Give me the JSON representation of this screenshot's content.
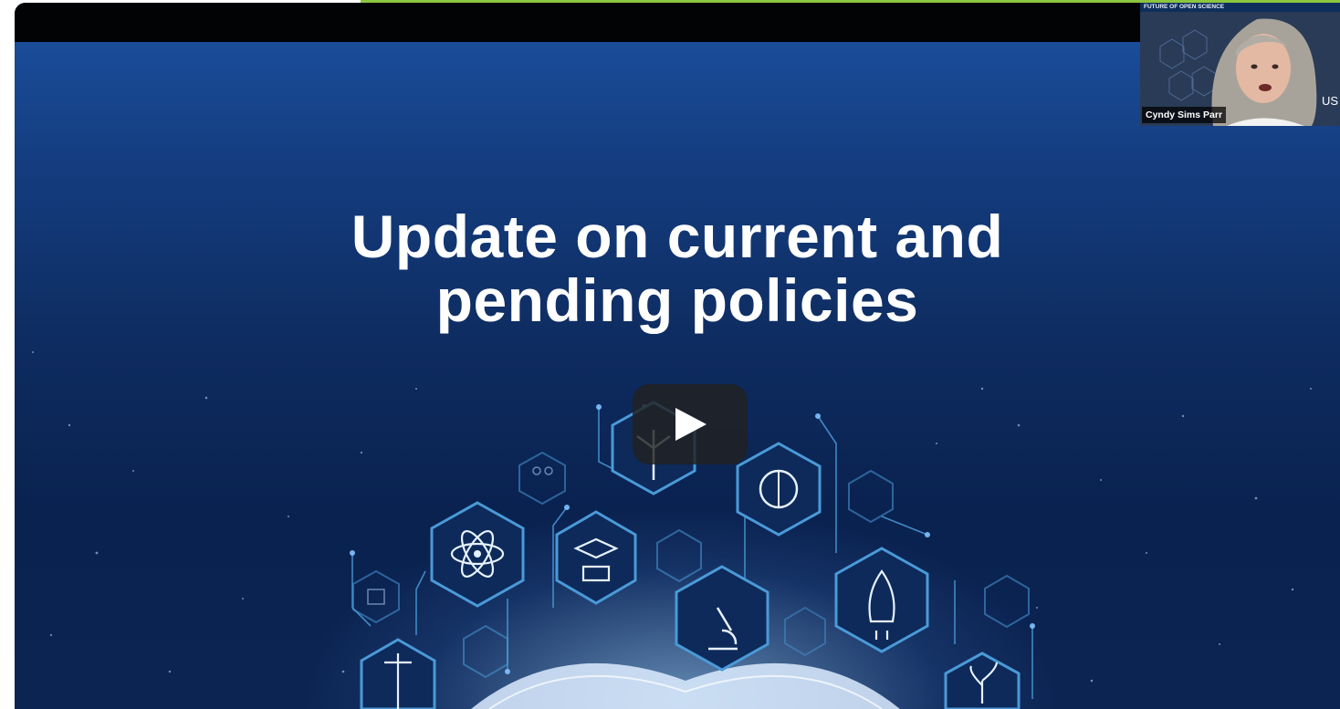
{
  "video": {
    "slide_title_line1": "Update on current and",
    "slide_title_line2": "pending policies",
    "play_icon": "play-icon"
  },
  "webcam": {
    "banner": "FUTURE OF OPEN SCIENCE",
    "participant_name": "Cyndy Sims Parr",
    "side_text": "US"
  },
  "colors": {
    "accent_green": "#8cc63f",
    "slide_blue": "#143d80",
    "hex_cyan": "#4a9ad8"
  }
}
